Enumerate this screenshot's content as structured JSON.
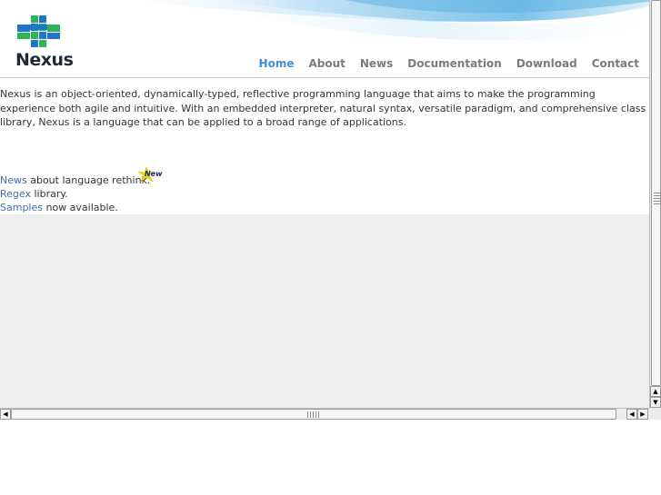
{
  "logo": {
    "text": "Nexus"
  },
  "nav": {
    "items": [
      {
        "label": "Home",
        "active": true
      },
      {
        "label": "About",
        "active": false
      },
      {
        "label": "News",
        "active": false
      },
      {
        "label": "Documentation",
        "active": false
      },
      {
        "label": "Download",
        "active": false
      },
      {
        "label": "Contact",
        "active": false
      }
    ]
  },
  "intro": {
    "text": "Nexus is an object-oriented, dynamically-typed, reflective programming language that aims to make the programming experience both agile and intuitive. With an embedded interpreter, natural syntax, versatile paradigm, and comprehensive class library, Nexus is a language that can be applied to a broad range of applications."
  },
  "news": [
    {
      "link": "News",
      "text": " about language rethink."
    },
    {
      "link": "Regex",
      "text": " library."
    },
    {
      "link": "Samples",
      "text": " now available."
    }
  ],
  "badge": {
    "text": "New"
  },
  "colors": {
    "accent": "#3f8fd6",
    "link": "#3f6fa6",
    "nav_text": "#7b7b7b",
    "logo_blue": "#1e78c8",
    "logo_green": "#2db35a"
  }
}
